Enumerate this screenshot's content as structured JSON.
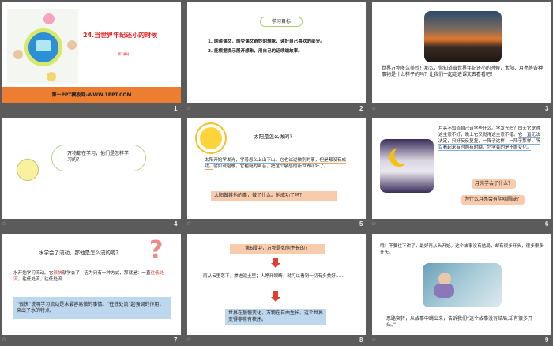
{
  "slides": [
    {
      "number": "1",
      "title": "24.当世界年纪还小的时候",
      "subtitle": "第2课时",
      "footer": "第一PPT模板网-WWW.1PPT.COM"
    },
    {
      "number": "2",
      "heading": "学习目标",
      "items": [
        "1. 朗读课文，感受课文奇妙的想象，读好自己喜欢的部分。",
        "2. 能根据提示展开想象，用自己的话续编故事。"
      ]
    },
    {
      "number": "3",
      "text": "世界万物多么美妙！那么，你知道当世界年纪还小的时候，太阳、月亮等各种事物是什么样子的吗？让我们一起走进课文去看看吧！"
    },
    {
      "number": "4",
      "bubble": "万物都在学习，他们是怎样学习的？"
    },
    {
      "number": "5",
      "heading": "太阳是怎么做的?",
      "text_a": "太阳开始学发光，学着怎么上山下山。",
      "text_b": "它也试过做别的事，但是都没有成功。",
      "text_c": "譬如说唱歌，它粗糙的声音，把这个敏感的新世界吓坏了。",
      "question": "太阳做其他的事，做了什么。他成功了吗？"
    },
    {
      "number": "6",
      "text_a": "月亮不知道自己该学些什么。学发光吗？白天它觉得这主意不好，晚上它又觉得这主意不错。",
      "text_b": "它一直无法决定，只好反反复复，一阵子这样，一阵子那样，所以看起来有时圆有时缺。它学会的是不断变化。",
      "q1": "月亮学会了什么？",
      "q2": "为什么月亮会有阴晴圆缺？"
    },
    {
      "number": "7",
      "heading": "水学会了流动，那他是怎么流的呢？",
      "t1": "水开始学习流动。它",
      "t2": "很快",
      "t3": "就学会了，因为只有一种方式，那就是：一直",
      "t4": "往低处流",
      "t5": "，往低处流，往低处流……",
      "note": "“很快”说明学习流动是水最容易做的事情。“往低处流”起强调的作用，突出了水的特点。"
    },
    {
      "number": "8",
      "q": "第6段中，万物是如何生长的？",
      "text": "雨从云里落下，渗进泥土里；人睁开眼睛，就可以看到一切有多美好……",
      "answer": "世界在慢慢变化，万物在自由生长。这个世界变得非常有秩序。"
    },
    {
      "number": "9",
      "text": "哦！不要往下讲了，最好再从头开始。这个故事没有结局，却有很多开头，很多很多开头。",
      "bottom": "思路突转，从故事中跳出来，告诉我们“这个故事没有结局,却有很多开头。”"
    }
  ],
  "colors": {
    "accent_orange": "#ed7d31",
    "title_red": "#e8201e",
    "peach": "#f8cbad",
    "blue": "#bdd7ee"
  }
}
